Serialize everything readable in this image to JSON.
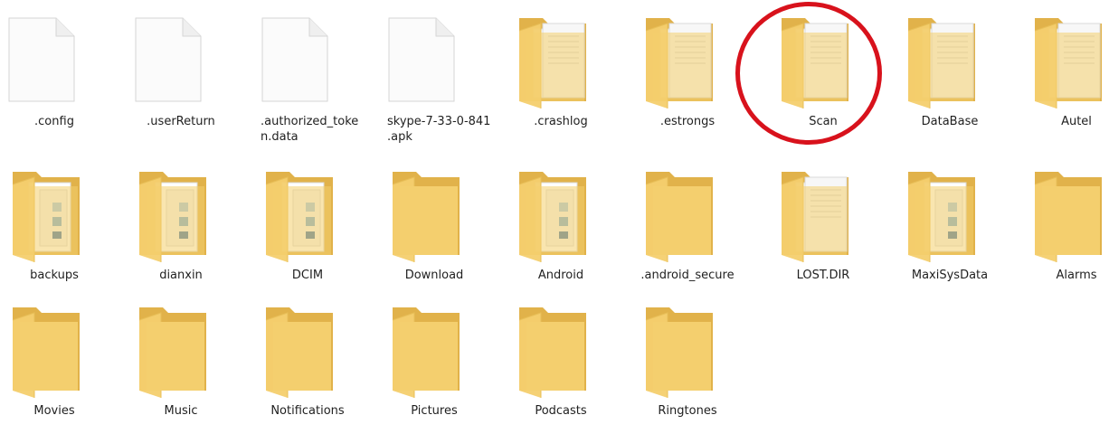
{
  "accent_colors": {
    "folder": "#f4cf6e",
    "folder_dark": "#e1b24a",
    "highlight": "#d8121c"
  },
  "items": [
    {
      "label": ".config",
      "type": "file",
      "icon": "blank-file-icon"
    },
    {
      "label": ".userReturn",
      "type": "file",
      "icon": "blank-file-icon"
    },
    {
      "label": ".authorized_toke n.data",
      "type": "file",
      "icon": "blank-file-icon"
    },
    {
      "label": "skype-7-33-0-841 .apk",
      "type": "file",
      "icon": "blank-file-icon"
    },
    {
      "label": ".crashlog",
      "type": "folder",
      "icon": "folder-documents-icon"
    },
    {
      "label": ".estrongs",
      "type": "folder",
      "icon": "folder-documents-icon"
    },
    {
      "label": "Scan",
      "type": "folder",
      "icon": "folder-documents-icon"
    },
    {
      "label": "DataBase",
      "type": "folder",
      "icon": "folder-documents-icon"
    },
    {
      "label": "Autel",
      "type": "folder",
      "icon": "folder-documents-icon"
    },
    {
      "label": "backups",
      "type": "folder",
      "icon": "folder-images-icon"
    },
    {
      "label": "dianxin",
      "type": "folder",
      "icon": "folder-images-icon"
    },
    {
      "label": "DCIM",
      "type": "folder",
      "icon": "folder-images-icon"
    },
    {
      "label": "Download",
      "type": "folder",
      "icon": "folder-icon"
    },
    {
      "label": "Android",
      "type": "folder",
      "icon": "folder-images-icon"
    },
    {
      "label": ".android_secure",
      "type": "folder",
      "icon": "folder-icon"
    },
    {
      "label": "LOST.DIR",
      "type": "folder",
      "icon": "folder-documents-icon"
    },
    {
      "label": "MaxiSysData",
      "type": "folder",
      "icon": "folder-images-icon"
    },
    {
      "label": "Alarms",
      "type": "folder",
      "icon": "folder-icon"
    },
    {
      "label": "Movies",
      "type": "folder",
      "icon": "folder-icon"
    },
    {
      "label": "Music",
      "type": "folder",
      "icon": "folder-icon"
    },
    {
      "label": "Notifications",
      "type": "folder",
      "icon": "folder-icon"
    },
    {
      "label": "Pictures",
      "type": "folder",
      "icon": "folder-icon"
    },
    {
      "label": "Podcasts",
      "type": "folder",
      "icon": "folder-icon"
    },
    {
      "label": "Ringtones",
      "type": "folder",
      "icon": "folder-icon"
    }
  ],
  "highlighted_item": "Scan"
}
